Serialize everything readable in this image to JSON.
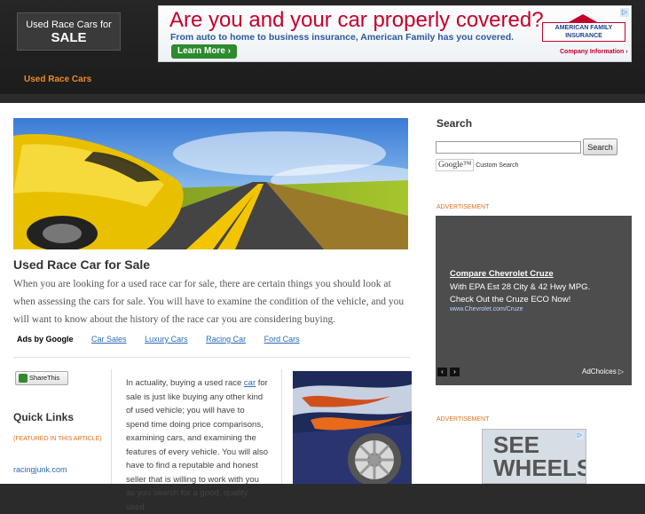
{
  "header": {
    "logo_line1": "Used Race Cars for",
    "logo_line2": "SALE",
    "nav_item": "Used Race Cars"
  },
  "top_banner": {
    "headline": "Are you and your car properly covered?",
    "subtext": "From auto to home to business insurance, American Family has you covered.",
    "button_label": "Learn More ›",
    "brand_line1": "AMERICAN FAMILY",
    "brand_line2": "INSURANCE",
    "company_info": "Company Information ›",
    "ad_icon": "▷"
  },
  "post": {
    "title": "Used Race Car for Sale",
    "intro": "When you are looking for a used race car for sale, there are certain things you should look at when assessing the cars for sale.  You will have to examine the condition of the vehicle, and you will want to know about the history of the race car you are considering buying.",
    "ads_by_google": "Ads by Google",
    "ad_links": [
      "Car Sales",
      "Luxury Cars",
      "Racing Car",
      "Ford Cars"
    ],
    "share_label": "ShareThis",
    "article_before": "In actuality, buying a used race ",
    "article_keyword": "car",
    "article_after": " for sale is just like buying any other kind of used vehicle; you will have to spend time doing price comparisons, examining cars, and examining the features of every vehicle.  You will also have to find a reputable and honest seller that is willing to work with you as you search for a good, quality used"
  },
  "quick_links": {
    "title": "Quick Links",
    "featured": "(FEATURED IN THIS ARTICLE)",
    "items": [
      "racingjunk.com"
    ]
  },
  "sidebar": {
    "search_title": "Search",
    "search_value": "",
    "search_button": "Search",
    "google_label": "Google™",
    "custom_search": "Custom Search",
    "advertisement_label": "ADVERTISEMENT",
    "ad": {
      "title": "Compare Chevrolet Cruze",
      "line1": "With EPA Est 28 City & 42 Hwy MPG.",
      "line2": "Check Out the Cruze ECO Now!",
      "url": "www.Chevrolet.com/Cruze",
      "adchoices": "AdChoices ▷",
      "prev_icon": "‹",
      "next_icon": "›"
    },
    "second_ad_text_1": "SEE",
    "second_ad_text_2": "WHEELS"
  }
}
